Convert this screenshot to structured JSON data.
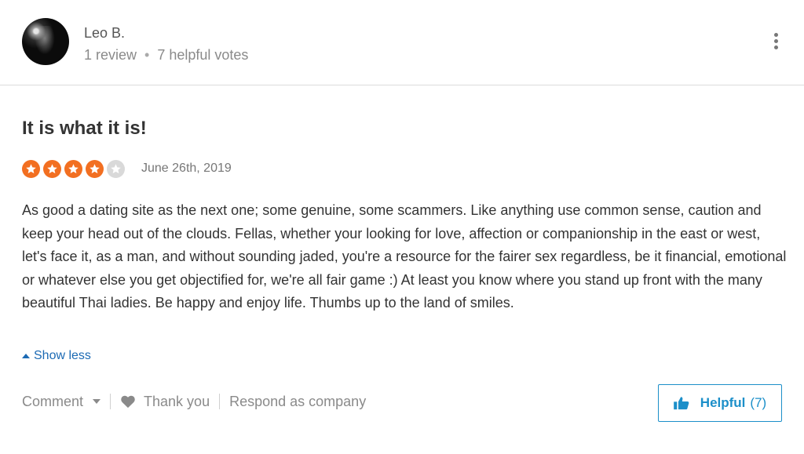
{
  "user": {
    "name": "Leo B.",
    "reviews": "1 review",
    "separator": "•",
    "votes": "7 helpful votes"
  },
  "review": {
    "title": "It is what it is!",
    "rating": 4,
    "rating_max": 5,
    "date": "June 26th, 2019",
    "body": "As good a dating site as the next one; some genuine, some scammers. Like anything use common sense, caution and keep your head out of the clouds. Fellas, whether your looking for love, affection or companionship in the east or west, let's face it, as a man, and without sounding jaded, you're a resource for the fairer sex regardless, be it financial, emotional or whatever else you get objectified for, we're all fair game :) At least you know where you stand up front with the many beautiful Thai ladies. Be happy and enjoy life. Thumbs up to the land of smiles."
  },
  "show_less": "Show less",
  "actions": {
    "comment": "Comment",
    "thank_you": "Thank you",
    "respond": "Respond as company",
    "helpful_label": "Helpful",
    "helpful_count": "(7)"
  },
  "colors": {
    "star_filled": "#f26f21",
    "star_empty": "#d9d9d9",
    "link": "#1c6ab4",
    "helpful": "#1c8fc9"
  },
  "icons": {
    "more": "more-vertical-icon",
    "heart": "heart-icon",
    "thumb": "thumbs-up-icon",
    "caret_up": "caret-up-icon",
    "caret_down": "caret-down-icon"
  }
}
